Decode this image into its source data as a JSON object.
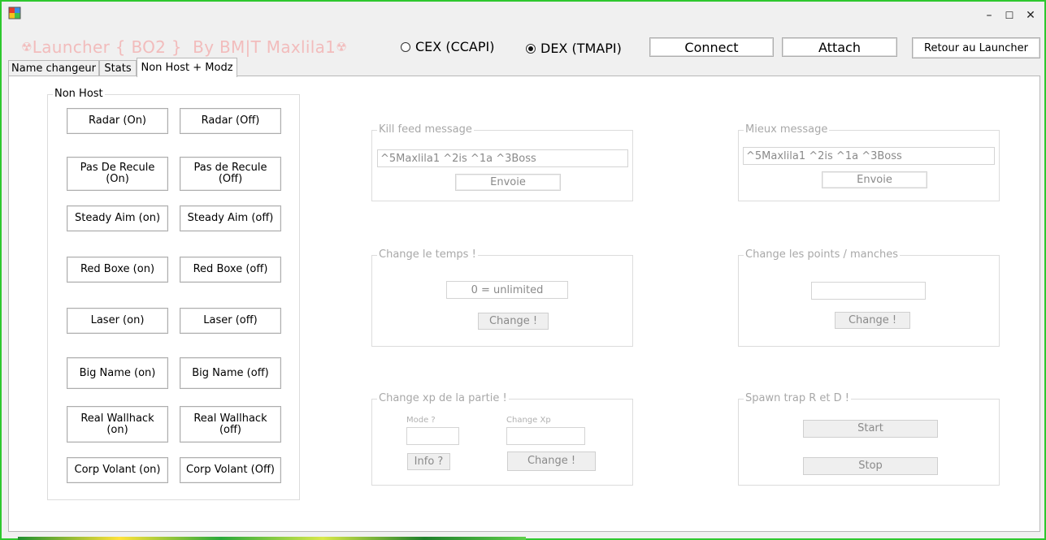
{
  "window": {
    "title_prefix_icon": "radiation-icon",
    "title_text": "Launcher { BO2 }  By BM|T Maxlila1",
    "title_suffix_icon": "radiation-icon",
    "controls": {
      "minimize": "–",
      "maximize": "☐",
      "close": "✕"
    }
  },
  "header": {
    "radio_cex": "CEX (CCAPI)",
    "radio_dex": "DEX (TMAPI)",
    "selected": "DEX (TMAPI)",
    "connect": "Connect",
    "attach": "Attach",
    "back": "Retour au Launcher"
  },
  "tabs": [
    {
      "label": "Name changeur"
    },
    {
      "label": "Stats"
    },
    {
      "label": "Non Host + Modz"
    }
  ],
  "non_host": {
    "title": "Non Host",
    "buttons": [
      {
        "on": "Radar (On)",
        "off": "Radar (Off)"
      },
      {
        "on": "Pas De Recule\n(On)",
        "off": "Pas de Recule\n(Off)"
      },
      {
        "on": "Steady Aim (on)",
        "off": "Steady Aim (off)"
      },
      {
        "on": "Red Boxe (on)",
        "off": "Red Boxe (off)"
      },
      {
        "on": "Laser (on)",
        "off": "Laser (off)"
      },
      {
        "on": "Big Name (on)",
        "off": "Big Name (off)"
      },
      {
        "on": "Real Wallhack\n(on)",
        "off": "Real Wallhack\n(off)"
      },
      {
        "on": "Corp Volant (on)",
        "off": "Corp Volant (Off)"
      }
    ]
  },
  "killfeed": {
    "title": "Kill feed message",
    "value": "^5Maxlila1 ^2is ^1a ^3Boss",
    "button": "Envoie"
  },
  "mieux": {
    "title": "Mieux message",
    "value": "^5Maxlila1 ^2is ^1a ^3Boss",
    "button": "Envoie"
  },
  "temps": {
    "title": "Change le temps !",
    "value": "0 = unlimited",
    "button": "Change !"
  },
  "points": {
    "title": "Change les points / manches",
    "value": "",
    "button": "Change !"
  },
  "xp": {
    "title": "Change xp de la partie !",
    "mode_label": "Mode ?",
    "xp_label": "Change Xp",
    "info_button": "Info ?",
    "change_button": "Change !"
  },
  "spawn": {
    "title": "Spawn trap R et D !",
    "start": "Start",
    "stop": "Stop"
  },
  "colors": {
    "window_border": "#2ec82e",
    "title_text": "#f2bcbc",
    "disabled_text": "#a8a8a8"
  }
}
